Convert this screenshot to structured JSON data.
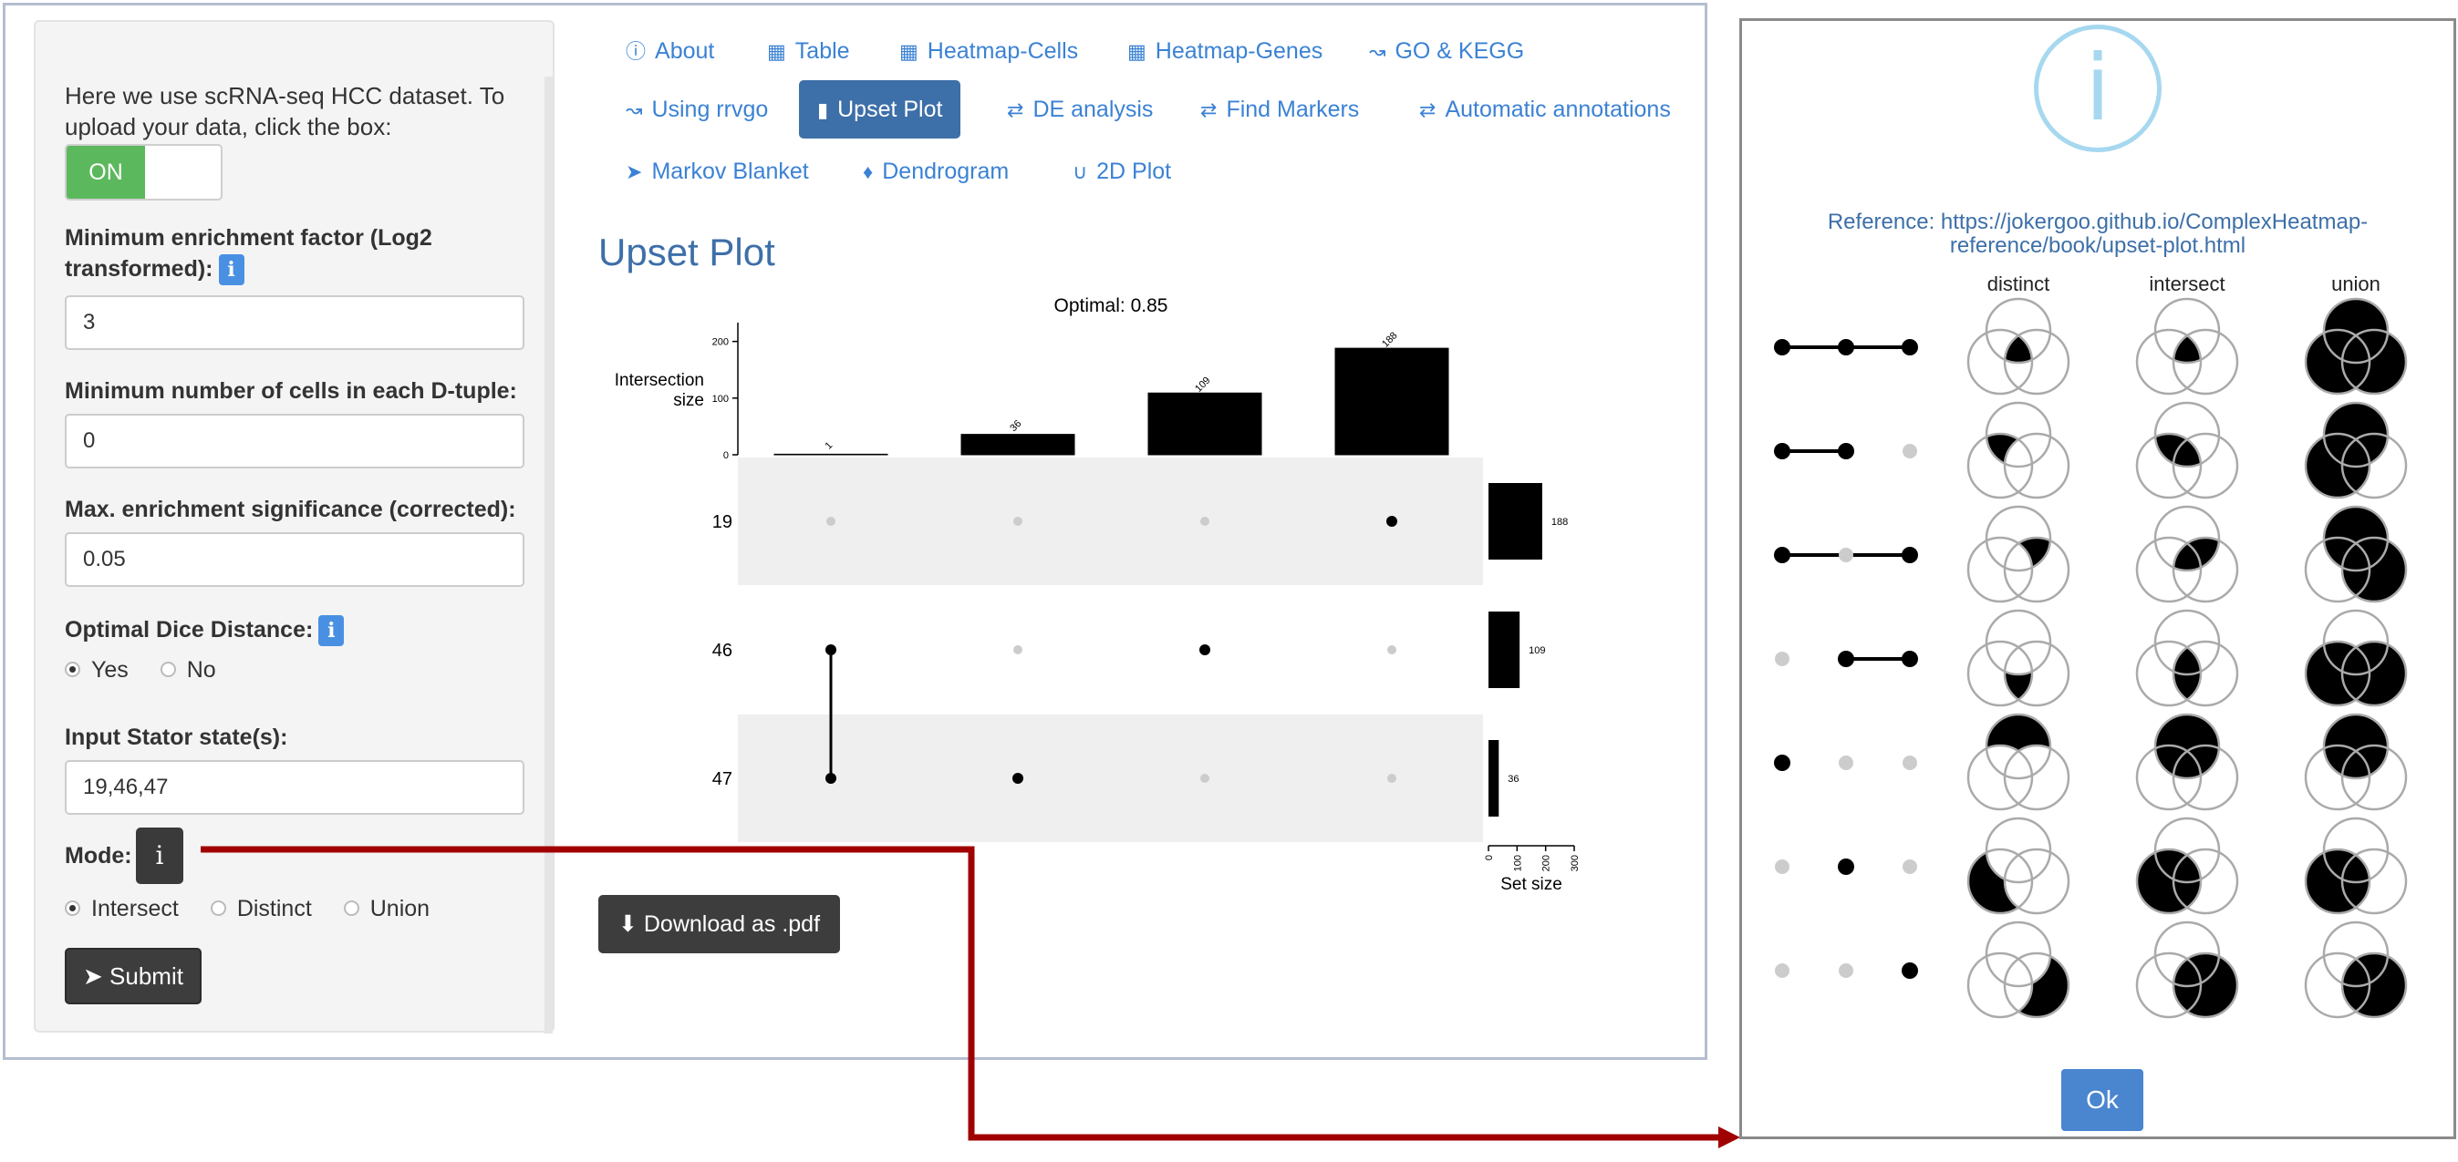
{
  "sidebar": {
    "intro_text": "Here we use scRNA-seq HCC dataset. To upload your data, click the box:",
    "toggle_label": "ON",
    "enrichment_label": "Minimum enrichment factor (Log2 transformed):",
    "enrichment_value": "3",
    "min_cells_label": "Minimum number of cells in each D-tuple:",
    "min_cells_value": "0",
    "max_sig_label": "Max. enrichment significance (corrected):",
    "max_sig_value": "0.05",
    "dice_label": "Optimal Dice Distance:",
    "dice_options": [
      "Yes",
      "No"
    ],
    "dice_selected": "Yes",
    "states_label": "Input Stator state(s):",
    "states_value": "19,46,47",
    "mode_label": "Mode:",
    "mode_options": [
      "Intersect",
      "Distinct",
      "Union"
    ],
    "mode_selected": "Intersect",
    "submit_label": "Submit",
    "info_glyph": "i"
  },
  "nav": {
    "tabs": [
      {
        "label": "About",
        "icon": "info-circle-icon",
        "active": false
      },
      {
        "label": "Table",
        "icon": "table-icon",
        "active": false
      },
      {
        "label": "Heatmap-Cells",
        "icon": "map-icon",
        "active": false
      },
      {
        "label": "Heatmap-Genes",
        "icon": "map-icon",
        "active": false
      },
      {
        "label": "GO & KEGG",
        "icon": "line-chart-icon",
        "active": false
      },
      {
        "label": "Using rrvgo",
        "icon": "line-chart-icon",
        "active": false
      },
      {
        "label": "Upset Plot",
        "icon": "signal-bars-icon",
        "active": true
      },
      {
        "label": "DE analysis",
        "icon": "shuffle-icon",
        "active": false
      },
      {
        "label": "Find Markers",
        "icon": "shuffle-icon",
        "active": false
      },
      {
        "label": "Automatic annotations",
        "icon": "shuffle-icon",
        "active": false
      },
      {
        "label": "Markov Blanket",
        "icon": "send-icon",
        "active": false
      },
      {
        "label": "Dendrogram",
        "icon": "bell-icon",
        "active": false
      },
      {
        "label": "2D Plot",
        "icon": "magnet-icon",
        "active": false
      }
    ]
  },
  "main": {
    "title": "Upset Plot",
    "download_label": "Download as .pdf"
  },
  "chart_data": {
    "type": "bar",
    "title": "Optimal: 0.85",
    "top_ylabel": "Intersection size",
    "top_yticks": [
      0,
      100,
      200
    ],
    "top_ylim": [
      0,
      230
    ],
    "intersections": [
      {
        "members": [
          "19"
        ],
        "size": 188
      },
      {
        "members": [
          "46"
        ],
        "size": 109
      },
      {
        "members": [
          "47"
        ],
        "size": 36
      },
      {
        "members": [
          "46",
          "47"
        ],
        "size": 1
      }
    ],
    "sets": [
      {
        "name": "19",
        "size": 188
      },
      {
        "name": "46",
        "size": 109
      },
      {
        "name": "47",
        "size": 36
      }
    ],
    "set_xlabel": "Set size",
    "set_xticks": [
      0,
      100,
      200,
      300
    ],
    "set_xlim": [
      0,
      300
    ]
  },
  "modal": {
    "icon_glyph": "i",
    "reference_text": "Reference: https://jokergoo.github.io/ComplexHeatmap-reference/book/upset-plot.html",
    "columns": [
      "distinct",
      "intersect",
      "union"
    ],
    "ok_label": "Ok"
  },
  "colors": {
    "accent": "#3b82d4",
    "active_tab": "#3d6fa8",
    "toggle_on": "#5cb85c",
    "arrow": "#a00000",
    "modal_icon": "#a6d8ef"
  }
}
